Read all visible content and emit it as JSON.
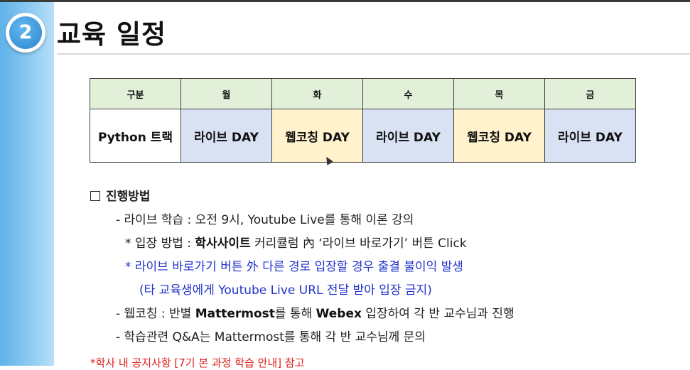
{
  "slide": {
    "number": "2",
    "title": "교육 일정"
  },
  "schedule": {
    "headers": [
      "구분",
      "월",
      "화",
      "수",
      "목",
      "금"
    ],
    "row": [
      "Python 트랙",
      "라이브 DAY",
      "웹코칭 DAY",
      "라이브 DAY",
      "웹코칭 DAY",
      "라이브 DAY"
    ]
  },
  "method": {
    "heading": "진행방법",
    "live_line": "- 라이브 학습 : 오전 9시, Youtube Live를 통해 이론 강의",
    "entry_prefix": "* 입장 방법 : ",
    "entry_bold": "학사사이트",
    "entry_suffix": " 커리큘럼 內 ‘라이브 바로가기’ 버튼 Click",
    "warning_line1": "* 라이브 바로가기 버튼 外 다른 경로 입장할 경우 출결 불이익 발생",
    "warning_line2": "(타 교육생에게 Youtube Live URL 전달 받아 입장 금지)",
    "web_prefix": "- 웹코칭 : 반별 ",
    "web_bold1": "Mattermost",
    "web_mid": "를 통해 ",
    "web_bold2": "Webex",
    "web_suffix": " 입장하여 각 반 교수님과 진행",
    "qa_line": "- 학습관련 Q&A는 Mattermost를 통해 각 반 교수님께 문의",
    "notice_line": "*학사 내 공지사항 [7기 본 과정 학습 안내] 참고"
  },
  "colors": {
    "header_fill": "#e2efd9",
    "live_fill": "#d9e2f3",
    "webcoaching_fill": "#fff2cc",
    "accent_blue": "#2233cc",
    "notice_red": "#e0201e"
  },
  "icons": [
    "number-badge-icon",
    "checkbox-icon",
    "mouse-cursor-icon"
  ]
}
